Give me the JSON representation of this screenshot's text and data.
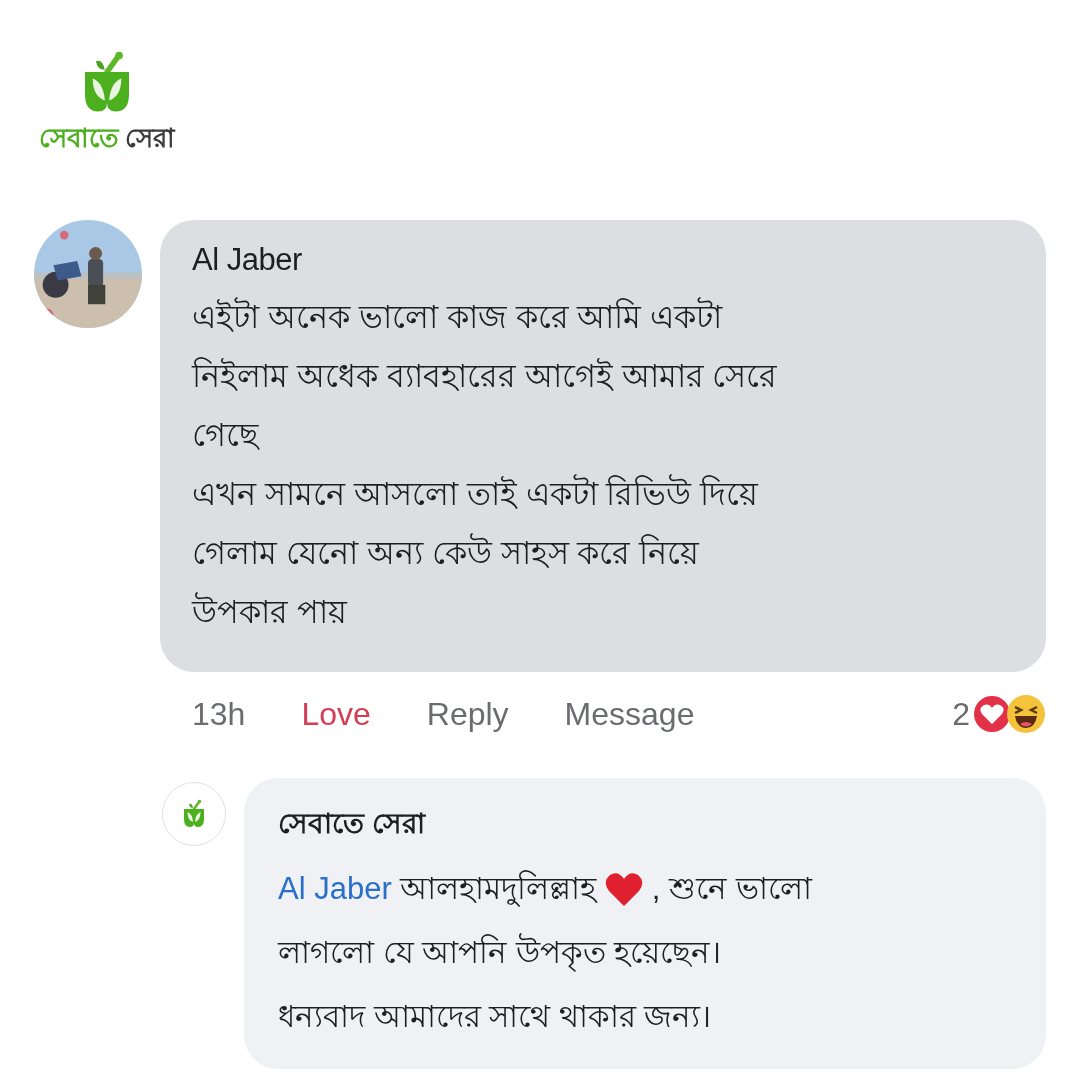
{
  "logo": {
    "words": [
      {
        "text": "সেবাতে",
        "color": "#4caf1e"
      },
      {
        "text": "সেরা",
        "color": "#3c3c3c"
      }
    ]
  },
  "comment": {
    "author": "Al Jaber",
    "lines": [
      "এইটা অনেক ভালো কাজ করে আমি একটা",
      "নিইলাম অধেক ব্যাবহারের আগেই আমার সেরে",
      "গেছে",
      "এখন সামনে আসলো তাই একটা রিভিউ দিয়ে",
      "গেলাম যেনো অন্য কেউ সাহস করে নিয়ে",
      "উপকার পায়"
    ],
    "time": "13h",
    "actions": [
      {
        "label": "Love",
        "selected": true
      },
      {
        "label": "Reply",
        "selected": false
      },
      {
        "label": "Message",
        "selected": false
      }
    ],
    "reaction_count": "2"
  },
  "reply": {
    "author": "সেবাতে সেরা",
    "mention": "Al Jaber",
    "first_line": [
      "আলহামদুলিল্লাহ",
      ", শুনে ভালো"
    ],
    "lines": [
      "লাগলো যে আপনি উপকৃত হয়েছেন।",
      "ধন্যবাদ আমাদের সাথে থাকার জন্য।"
    ]
  }
}
